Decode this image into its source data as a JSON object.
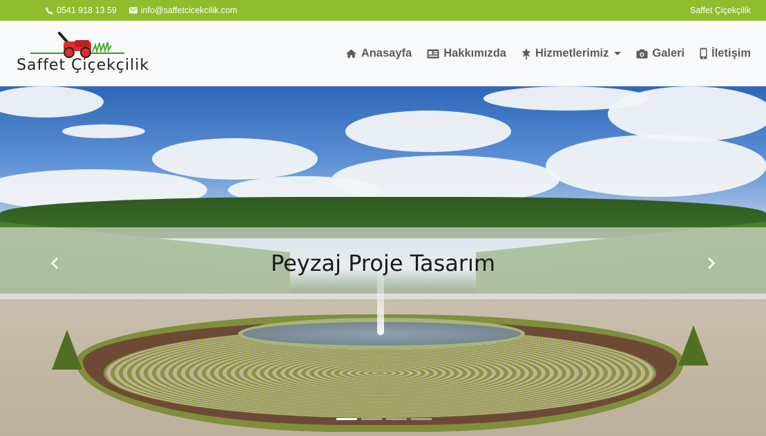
{
  "topbar": {
    "phone": "0541 918 13 59",
    "email": "info@saffetcicekcilik.com",
    "brand": "Saffet Çiçekçilik",
    "color": "#8fbd2d"
  },
  "logo": {
    "text": "Saffet Çiçekçilik"
  },
  "nav": {
    "items": [
      {
        "label": "Anasayfa",
        "icon": "home-icon"
      },
      {
        "label": "Hakkımızda",
        "icon": "id-card-icon"
      },
      {
        "label": "Hizmetlerimiz",
        "icon": "leaf-icon",
        "dropdown": true
      },
      {
        "label": "Galeri",
        "icon": "camera-icon"
      },
      {
        "label": "İletişim",
        "icon": "mobile-phone-icon"
      }
    ]
  },
  "hero": {
    "caption": "Peyzaj Proje Tasarım",
    "slides_total": 4,
    "active_slide": 1
  }
}
